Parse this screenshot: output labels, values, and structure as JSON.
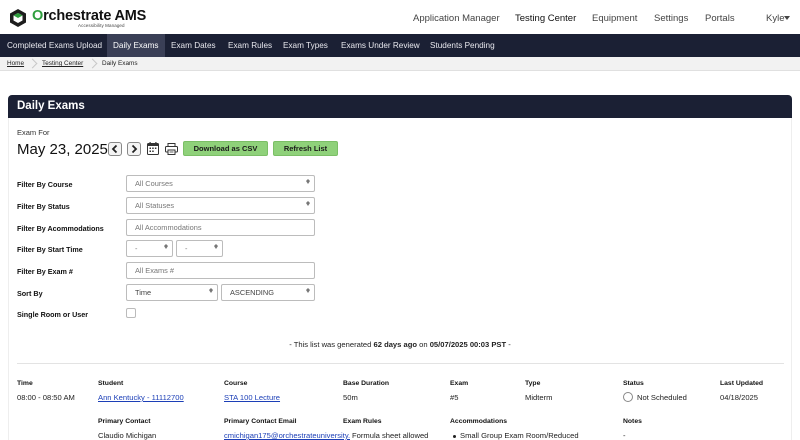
{
  "app": {
    "brand_first": "O",
    "brand_rest": "rchestrate AMS",
    "tagline": "Accessibility Managed",
    "top_nav": [
      "Application Manager",
      "Testing Center",
      "Equipment",
      "Settings",
      "Portals"
    ],
    "top_nav_active": "Testing Center",
    "user": "Kyle",
    "accent_color": "#2e9e3d",
    "nav_bg_color": "#1b2034"
  },
  "subnav": {
    "items": [
      "Completed Exams Upload",
      "Daily Exams",
      "Exam Dates",
      "Exam Rules",
      "Exam Types",
      "Exams Under Review",
      "Students Pending"
    ],
    "active": "Daily Exams"
  },
  "breadcrumb": [
    "Home",
    "Testing Center",
    "Daily Exams"
  ],
  "page": {
    "title": "Daily Exams",
    "exam_for_label": "Exam For",
    "date": "May 23, 2025",
    "prev_icon": "chevron-left-icon",
    "next_icon": "chevron-right-icon",
    "calendar_icon": "calendar-icon",
    "print_icon": "printer-icon",
    "download_label": "Download as CSV",
    "refresh_label": "Refresh List",
    "button_color": "#8fd17a"
  },
  "filters": {
    "course_label": "Filter By Course",
    "course_value": "All Courses",
    "status_label": "Filter By Status",
    "status_value": "All Statuses",
    "accommodations_label": "Filter By Acommodations",
    "accommodations_placeholder": "All Accommodations",
    "start_time_label": "Filter By Start Time",
    "start_hour": "-",
    "start_minute": "-",
    "exam_num_label": "Filter By Exam #",
    "exam_num_placeholder": "All Exams #",
    "sort_label": "Sort By",
    "sort_field": "Time",
    "sort_order": "ASCENDING",
    "single_room_label": "Single Room or User",
    "single_room_checked": false
  },
  "generated": {
    "prefix": "- This list was generated",
    "age": "62 days ago",
    "mid": "on",
    "timestamp": "05/07/2025 00:03 PST",
    "suffix": "-"
  },
  "exam_row": {
    "headers": {
      "time": "Time",
      "student": "Student",
      "course": "Course",
      "base_duration": "Base Duration",
      "exam": "Exam",
      "type": "Type",
      "status": "Status",
      "last_updated": "Last Updated",
      "primary_contact": "Primary Contact",
      "primary_contact_email": "Primary Contact Email",
      "exam_rules": "Exam Rules",
      "accommodations": "Accommodations",
      "notes": "Notes"
    },
    "time": "08:00 - 08:50 AM",
    "student": "Ann Kentucky - 11112700",
    "course": "STA 100 Lecture",
    "base_duration": "50m",
    "exam": "#5",
    "type": "Midterm",
    "status": "Not Scheduled",
    "last_updated": "04/18/2025",
    "primary_contact": "Claudio Michigan",
    "primary_contact_email": "cmichigan175@orchestrateuniversity.edu",
    "exam_rule": "Formula sheet allowed",
    "accommodation": "Small Group Exam Room/Reduced",
    "notes": "-"
  }
}
